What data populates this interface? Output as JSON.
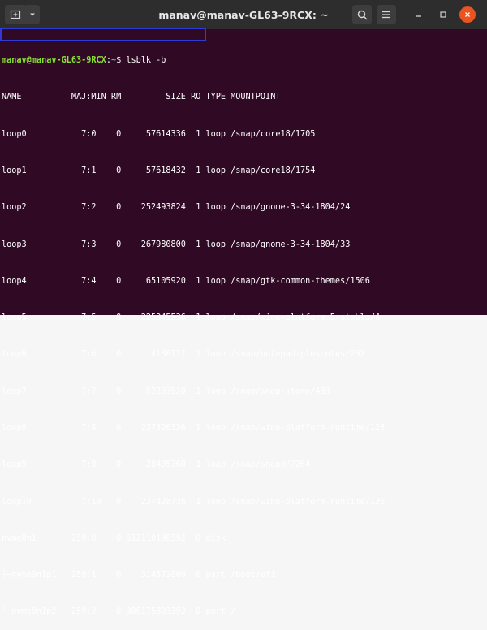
{
  "window": {
    "title": "manav@manav-GL63-9RCX: ~",
    "colors": {
      "titlebar": "#2d2d2d",
      "terminal_bg": "#300a24",
      "user": "#8ae234",
      "path": "#729fcf",
      "close": "#e95420",
      "highlight": "#2f3bd6"
    }
  },
  "prompt": {
    "user_host": "manav@manav-GL63-9RCX",
    "colon": ":",
    "path": "~",
    "dollar": "$",
    "command": " lsblk -b"
  },
  "header": "NAME          MAJ:MIN RM         SIZE RO TYPE MOUNTPOINT",
  "rows": [
    "loop0           7:0    0     57614336  1 loop /snap/core18/1705",
    "loop1           7:1    0     57618432  1 loop /snap/core18/1754",
    "loop2           7:2    0    252493824  1 loop /snap/gnome-3-34-1804/24",
    "loop3           7:3    0    267980800  1 loop /snap/gnome-3-34-1804/33",
    "loop4           7:4    0     65105920  1 loop /snap/gtk-common-themes/1506",
    "loop5           7:5    0    225345536  1 loop /snap/wine-platform-5-stable/4",
    "loop6           7:6    0      4186112  1 loop /snap/notepad-plus-plus/232",
    "loop7           7:7    0     52203520  1 loop /snap/snap-store/433",
    "loop8           7:8    0    237326336  1 loop /snap/wine-platform-runtime/123",
    "loop9           7:9    0     28405760  1 loop /snap/snapd/7264",
    "loop10          7:10   0    237428736  1 loop /snap/wine-platform-runtime/136",
    "nvme0n1       259:0    0 512110190592  0 disk",
    "├─nvme0n1p1   259:1    0    314572800  0 part /boot/efi",
    "└─nvme0n1p2   259:2    0 306175803392  0 part /"
  ]
}
